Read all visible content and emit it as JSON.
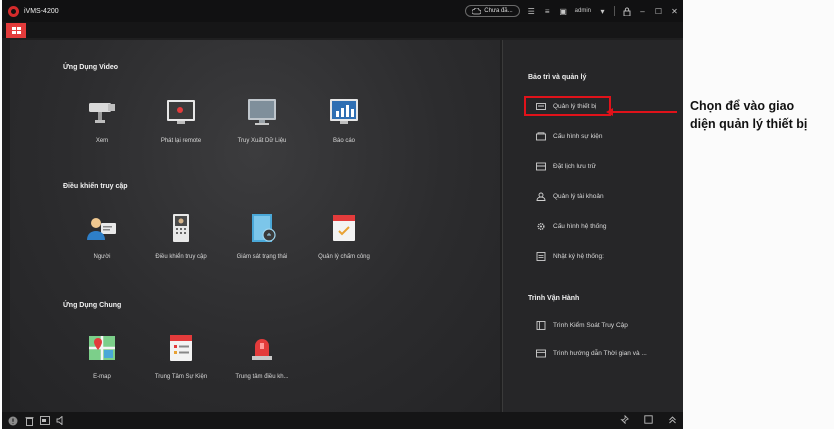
{
  "window": {
    "title": "iVMS-4200",
    "cloud_status": "Chưa đă...",
    "user": "admin"
  },
  "sections": [
    {
      "title": "Ứng Dụng Video",
      "tiles": [
        "Xem",
        "Phát lại remote",
        "Truy Xuất Dữ Liệu",
        "Báo cáo"
      ]
    },
    {
      "title": "Điều khiển truy cập",
      "tiles": [
        "Người",
        "Điều khiển truy cập",
        "Giám sát trạng thái",
        "Quản lý chấm công"
      ]
    },
    {
      "title": "Ứng Dụng Chung",
      "tiles": [
        "E-map",
        "Trung Tâm Sự Kiện",
        "Trung tâm điều kh..."
      ]
    }
  ],
  "right_panel": {
    "maintenance_title": "Bảo trì và quản lý",
    "maintenance_items": [
      "Quản lý thiết bị",
      "Cấu hình sự kiện",
      "Đặt lịch lưu trữ",
      "Quản lý tài khoản",
      "Cấu hình hệ thống",
      "Nhật ký hệ thống:"
    ],
    "wizard_title": "Trình Vận Hành",
    "wizard_items": [
      "Trình Kiểm Soát Truy Cập",
      "Trình hướng dẫn Thời gian và ..."
    ]
  },
  "annotation": {
    "line1": "Chọn để vào giao",
    "line2": "diện quản lý thiết bị"
  },
  "colors": {
    "accent": "#e33b3b",
    "highlight": "#e0121a",
    "background": "#2c2c2e"
  }
}
